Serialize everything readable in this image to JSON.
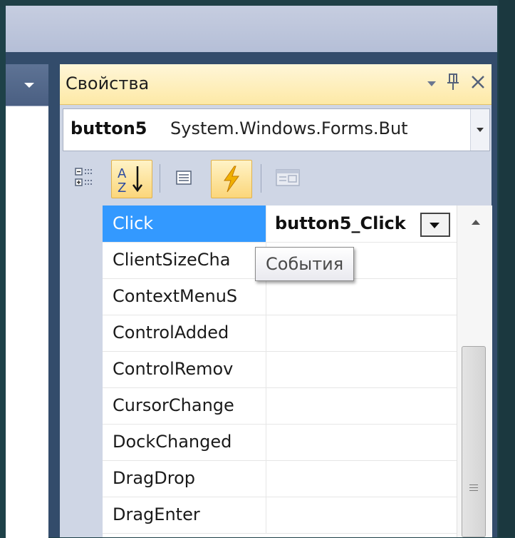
{
  "panel": {
    "title": "Свойства",
    "title_icons": [
      "dropdown-icon",
      "pin-icon",
      "close-icon"
    ]
  },
  "object_selector": {
    "name": "button5",
    "type": "System.Windows.Forms.But"
  },
  "toolbar": {
    "buttons": [
      "categorized-icon",
      "alphabetical-icon",
      "properties-icon",
      "events-icon",
      "property-pages-icon"
    ],
    "active": [
      "alphabetical",
      "events"
    ]
  },
  "events": [
    {
      "name": "Click",
      "value": "button5_Click",
      "selected": true
    },
    {
      "name": "ClientSizeCha",
      "value": ""
    },
    {
      "name": "ContextMenuS",
      "value": ""
    },
    {
      "name": "ControlAdded",
      "value": ""
    },
    {
      "name": "ControlRemov",
      "value": ""
    },
    {
      "name": "CursorChange",
      "value": ""
    },
    {
      "name": "DockChanged",
      "value": ""
    },
    {
      "name": "DragDrop",
      "value": ""
    },
    {
      "name": "DragEnter",
      "value": ""
    }
  ],
  "tooltip": "События",
  "colors": {
    "selection": "#3399ff",
    "title_bar": "#fde9a6",
    "background": "#1e4148"
  }
}
